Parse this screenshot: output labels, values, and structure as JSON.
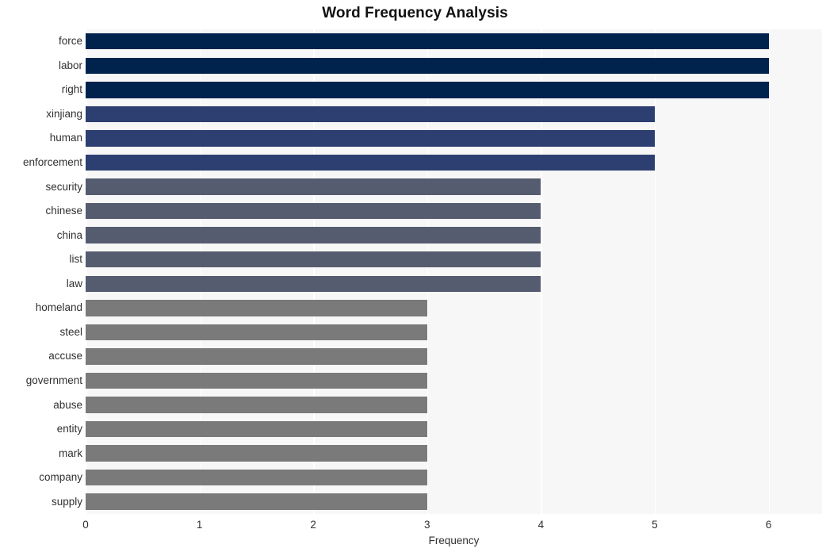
{
  "chart_data": {
    "type": "bar",
    "orientation": "horizontal",
    "title": "Word Frequency Analysis",
    "xlabel": "Frequency",
    "ylabel": "",
    "categories": [
      "force",
      "labor",
      "right",
      "xinjiang",
      "human",
      "enforcement",
      "security",
      "chinese",
      "china",
      "list",
      "law",
      "homeland",
      "steel",
      "accuse",
      "government",
      "abuse",
      "entity",
      "mark",
      "company",
      "supply"
    ],
    "values": [
      6,
      6,
      6,
      5,
      5,
      5,
      4,
      4,
      4,
      4,
      4,
      3,
      3,
      3,
      3,
      3,
      3,
      3,
      3,
      3
    ],
    "bar_colors": [
      "#00234d",
      "#00234d",
      "#00234d",
      "#2d3f70",
      "#2d3f70",
      "#2d3f70",
      "#565c70",
      "#565c70",
      "#565c70",
      "#565c70",
      "#565c70",
      "#7a7a7a",
      "#7a7a7a",
      "#7a7a7a",
      "#7a7a7a",
      "#7a7a7a",
      "#7a7a7a",
      "#7a7a7a",
      "#7a7a7a",
      "#7a7a7a"
    ],
    "xlim": [
      0,
      6.47
    ],
    "ylim": [
      0,
      20
    ],
    "x_ticks": [
      0,
      1,
      2,
      3,
      4,
      5,
      6
    ],
    "x_tick_labels": [
      "0",
      "1",
      "2",
      "3",
      "4",
      "5",
      "6"
    ],
    "grid": true,
    "grid_axis": "x",
    "grid_color": "#ffffff",
    "plot_background": "#f7f7f7",
    "figure_background": "#ffffff",
    "legend": null
  }
}
